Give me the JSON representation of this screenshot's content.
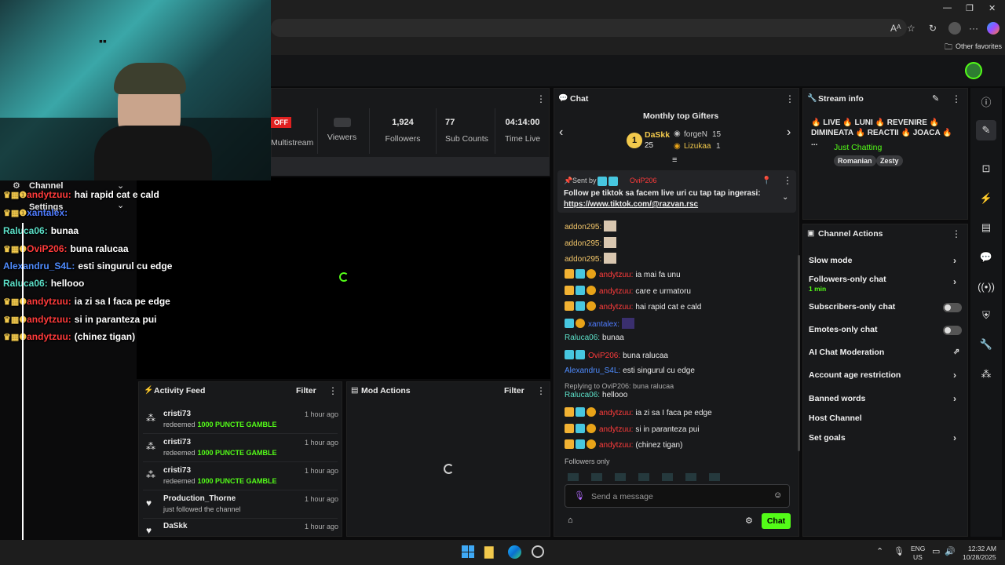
{
  "browser": {
    "other_favorites": "Other favorites"
  },
  "webcam": {
    "menu": [
      {
        "label": "Channel"
      },
      {
        "label": "Settings"
      }
    ]
  },
  "stream_panel": {
    "offline_badge": "OFF",
    "multistream_label": "Multistream",
    "stats": [
      {
        "value": "",
        "label": "Viewers"
      },
      {
        "value": "1,924",
        "label": "Followers"
      },
      {
        "value": "77",
        "label": "Sub Counts"
      },
      {
        "value": "04:14:00",
        "label": "Time Live"
      }
    ]
  },
  "overlay_chat": [
    {
      "user": "andytzuu:",
      "user_color": "#ff3b3b",
      "text": "hai rapid cat e cald"
    },
    {
      "user": "xantalex:",
      "user_color": "#4f7cff",
      "text": ""
    },
    {
      "user": "Raluca06:",
      "user_color": "#5ce0c8",
      "text": "bunaa"
    },
    {
      "user": "OviP206:",
      "user_color": "#ff3b3b",
      "text": "buna ralucaa"
    },
    {
      "user": "Alexandru_S4L:",
      "user_color": "#4f8cff",
      "text": "esti singurul cu edge"
    },
    {
      "user": "Raluca06:",
      "user_color": "#5ce0c8",
      "text": "hellooo"
    },
    {
      "user": "andytzuu:",
      "user_color": "#ff3b3b",
      "text": "ia zi sa I faca pe edge"
    },
    {
      "user": "andytzuu:",
      "user_color": "#ff3b3b",
      "text": "si in paranteza pui"
    },
    {
      "user": "andytzuu:",
      "user_color": "#ff3b3b",
      "text": "(chinez tigan)"
    }
  ],
  "activity_feed": {
    "title": "Activity Feed",
    "filter": "Filter",
    "items": [
      {
        "name": "cristi73",
        "action": "redeemed",
        "reward": "1000 PUNCTE GAMBLE",
        "time": "1 hour ago"
      },
      {
        "name": "cristi73",
        "action": "redeemed",
        "reward": "1000 PUNCTE GAMBLE",
        "time": "1 hour ago"
      },
      {
        "name": "cristi73",
        "action": "redeemed",
        "reward": "1000 PUNCTE GAMBLE",
        "time": "1 hour ago"
      },
      {
        "name": "Production_Thorne",
        "action": "just followed the channel",
        "reward": "",
        "time": "1 hour ago"
      },
      {
        "name": "DaSkk",
        "action": "",
        "reward": "",
        "time": "1 hour ago"
      }
    ]
  },
  "mod_actions": {
    "title": "Mod Actions",
    "filter": "Filter"
  },
  "chat": {
    "title": "Chat",
    "gifters_title": "Monthly top Gifters",
    "gifters": [
      {
        "rank": "1",
        "name": "DaSkk",
        "count": "25"
      },
      {
        "name": "forgeN",
        "count": "15"
      },
      {
        "name": "Lizukaa",
        "count": "1"
      }
    ],
    "pinned": {
      "sent_by": "Sent by",
      "user": "OviP206",
      "text": "Follow pe tiktok sa facem live uri cu tap tap ingerasi:",
      "link": "https://www.tiktok.com/@razvan.rsc"
    },
    "messages": [
      {
        "user": "addon295:",
        "color": "#f4c76a",
        "text": "",
        "badges": []
      },
      {
        "user": "addon295:",
        "color": "#f4c76a",
        "text": "",
        "badges": []
      },
      {
        "user": "addon295:",
        "color": "#f4c76a",
        "text": "",
        "badges": []
      },
      {
        "user": "andytzuu:",
        "color": "#ff3b3b",
        "text": "ia mai fa unu",
        "badges": [
          "crown",
          "sub",
          "one"
        ]
      },
      {
        "user": "andytzuu:",
        "color": "#ff3b3b",
        "text": "care e urmatoru",
        "badges": [
          "crown",
          "sub",
          "one"
        ]
      },
      {
        "user": "andytzuu:",
        "color": "#ff3b3b",
        "text": "hai rapid cat e cald",
        "badges": [
          "crown",
          "sub",
          "one"
        ]
      },
      {
        "user": "xantalex:",
        "color": "#4f7cff",
        "text": "",
        "badges": [
          "sub",
          "one"
        ]
      },
      {
        "user": "Raluca06:",
        "color": "#5ce0c8",
        "text": "bunaa",
        "badges": []
      },
      {
        "user": "OviP206:",
        "color": "#ff3b3b",
        "text": "buna ralucaa",
        "badges": [
          "sub",
          "sub"
        ]
      },
      {
        "user": "Alexandru_S4L:",
        "color": "#4f8cff",
        "text": "esti singurul cu edge",
        "badges": []
      },
      {
        "user": "Raluca06:",
        "color": "#5ce0c8",
        "text": "hellooo",
        "badges": []
      },
      {
        "user": "andytzuu:",
        "color": "#ff3b3b",
        "text": "ia zi sa I faca pe edge",
        "badges": [
          "crown",
          "sub",
          "one"
        ]
      },
      {
        "user": "andytzuu:",
        "color": "#ff3b3b",
        "text": "si in paranteza pui",
        "badges": [
          "crown",
          "sub",
          "one"
        ]
      },
      {
        "user": "andytzuu:",
        "color": "#ff3b3b",
        "text": "(chinez tigan)",
        "badges": [
          "crown",
          "sub",
          "one"
        ]
      }
    ],
    "reply_to": "Replying to OviP206: buna ralucaa",
    "followers_only": "Followers only",
    "input_placeholder": "Send a message",
    "send": "Chat"
  },
  "stream_info": {
    "title": "Stream info",
    "stream_title": "🔥 LIVE 🔥 LUNI 🔥 REVENIRE 🔥 DIMINEATA 🔥 REACTII 🔥 JOACA 🔥 ...",
    "category": "Just Chatting",
    "tags": [
      "Romanian",
      "Zesty"
    ]
  },
  "channel_actions": {
    "title": "Channel Actions",
    "items": [
      {
        "label": "Slow mode",
        "sub": "",
        "control": "chevron"
      },
      {
        "label": "Followers-only chat",
        "sub": "1 min",
        "control": "chevron"
      },
      {
        "label": "Subscribers-only chat",
        "sub": "",
        "control": "toggle"
      },
      {
        "label": "Emotes-only chat",
        "sub": "",
        "control": "toggle"
      },
      {
        "label": "AI Chat Moderation",
        "sub": "",
        "control": "external"
      },
      {
        "label": "Account age restriction",
        "sub": "",
        "control": "chevron"
      },
      {
        "label": "Banned words",
        "sub": "",
        "control": "chevron"
      },
      {
        "label": "Host Channel",
        "sub": "",
        "control": "none"
      },
      {
        "label": "Set goals",
        "sub": "",
        "control": "chevron"
      }
    ]
  },
  "taskbar": {
    "lang_top": "ENG",
    "lang_bottom": "US",
    "time": "12:32 AM",
    "date": "10/28/2025"
  },
  "colors": {
    "kick_green": "#53fc18",
    "panel": "#18191b",
    "bg": "#0b0b0c"
  }
}
